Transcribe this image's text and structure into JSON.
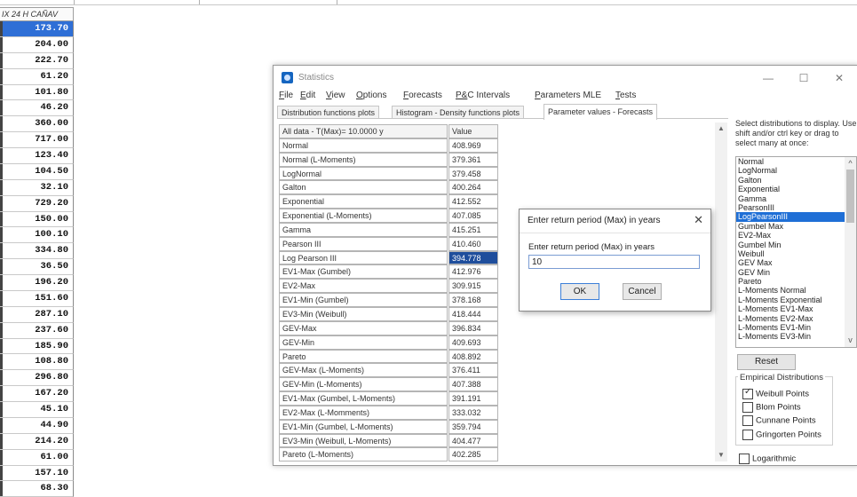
{
  "spreadsheet": {
    "header": "IX 24 H CAÑAV",
    "values": [
      "173.70",
      "204.00",
      "222.70",
      "61.20",
      "101.80",
      "46.20",
      "360.00",
      "717.00",
      "123.40",
      "104.50",
      "32.10",
      "729.20",
      "150.00",
      "100.10",
      "334.80",
      "36.50",
      "196.20",
      "151.60",
      "287.10",
      "237.60",
      "185.90",
      "108.80",
      "296.80",
      "167.20",
      "45.10",
      "44.90",
      "214.20",
      "61.00",
      "157.10",
      "68.30"
    ]
  },
  "window": {
    "title": "Statistics",
    "controls": [
      "—",
      "☐",
      "✕"
    ],
    "menu": [
      "File",
      "Edit",
      "View",
      "Options",
      "Forecasts",
      "P&C Intervals",
      "Parameters MLE",
      "Tests"
    ],
    "tabs": [
      "Distribution functions plots",
      "Histogram - Density functions plots",
      "Parameter values - Forecasts"
    ]
  },
  "table": {
    "header_name": "All data - T(Max)= 10.0000 y",
    "header_value": "Value",
    "rows": [
      [
        "Normal",
        "408.969"
      ],
      [
        "Normal (L-Moments)",
        "379.361"
      ],
      [
        "LogNormal",
        "379.458"
      ],
      [
        "Galton",
        "400.264"
      ],
      [
        "Exponential",
        "412.552"
      ],
      [
        "Exponential (L-Moments)",
        "407.085"
      ],
      [
        "Gamma",
        "415.251"
      ],
      [
        "Pearson III",
        "410.460"
      ],
      [
        "Log Pearson III",
        "394.778"
      ],
      [
        "EV1-Max (Gumbel)",
        "412.976"
      ],
      [
        "EV2-Max",
        "309.915"
      ],
      [
        "EV1-Min (Gumbel)",
        "378.168"
      ],
      [
        "EV3-Min (Weibull)",
        "418.444"
      ],
      [
        "GEV-Max",
        "396.834"
      ],
      [
        "GEV-Min",
        "409.693"
      ],
      [
        "Pareto",
        "408.892"
      ],
      [
        "GEV-Max (L-Moments)",
        "376.411"
      ],
      [
        "GEV-Min (L-Moments)",
        "407.388"
      ],
      [
        "EV1-Max (Gumbel, L-Moments)",
        "391.191"
      ],
      [
        "EV2-Max (L-Momments)",
        "333.032"
      ],
      [
        "EV1-Min (Gumbel, L-Moments)",
        "359.794"
      ],
      [
        "EV3-Min (Weibull, L-Moments)",
        "404.477"
      ],
      [
        "Pareto (L-Moments)",
        "402.285"
      ]
    ],
    "selected_row": 8
  },
  "side_panel": {
    "instructions": "Select distributions to display. Use shift and/or ctrl key or drag to select many at once:",
    "distributions": [
      "Normal",
      "LogNormal",
      "Galton",
      "Exponential",
      "Gamma",
      "PearsonIII",
      "LogPearsonIII",
      "Gumbel Max",
      "EV2-Max",
      "Gumbel Min",
      "Weibull",
      "GEV Max",
      "GEV Min",
      "Pareto",
      "L-Moments Normal",
      "L-Moments Exponential",
      "L-Moments EV1-Max",
      "L-Moments EV2-Max",
      "L-Moments EV1-Min",
      "L-Moments EV3-Min"
    ],
    "selected_distribution": "LogPearsonIII",
    "reset_label": "Reset",
    "empirical_title": "Empirical Distributions",
    "empirical": [
      {
        "label": "Weibull Points",
        "checked": true
      },
      {
        "label": "Blom Points",
        "checked": false
      },
      {
        "label": "Cunnane Points",
        "checked": false
      },
      {
        "label": "Gringorten Points",
        "checked": false
      }
    ],
    "logarithmic": {
      "label": "Logarithmic",
      "checked": false
    }
  },
  "dialog": {
    "title": "Enter return period (Max) in years",
    "prompt": "Enter return period (Max) in years",
    "input_value": "10",
    "ok_label": "OK",
    "cancel_label": "Cancel",
    "close": "✕"
  },
  "colors": {
    "selection": "#1f6fd6",
    "sheet_selection": "#2f6fd6"
  }
}
